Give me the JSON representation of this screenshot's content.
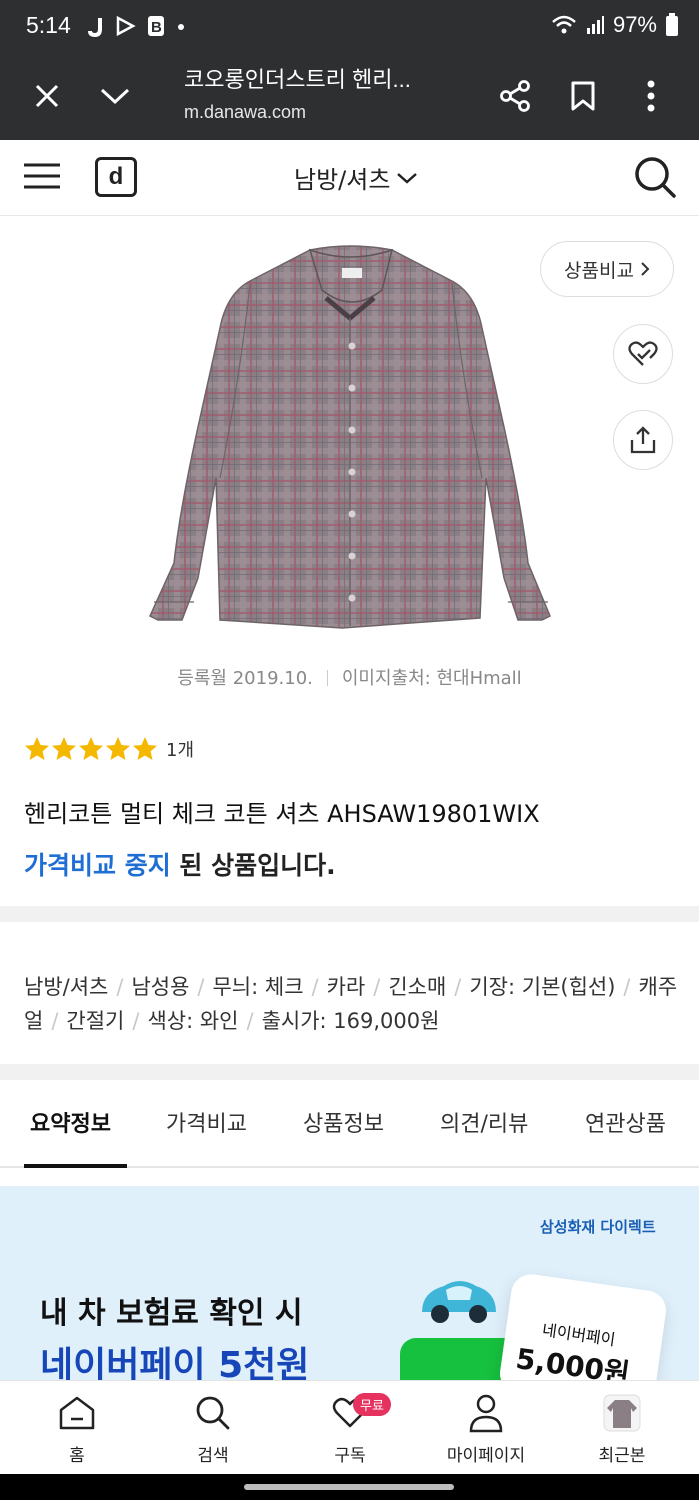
{
  "status_bar": {
    "time": "5:14",
    "battery": "97%"
  },
  "browser": {
    "title": "코오롱인더스트리 헨리...",
    "url": "m.danawa.com",
    "close_icon": "close-icon",
    "collapse_icon": "chevron-down-icon",
    "share_icon": "share-icon",
    "bookmark_icon": "bookmark-icon",
    "menu_icon": "more-vert-icon"
  },
  "header": {
    "logo": "d",
    "category": "남방/셔츠",
    "menu_icon": "hamburger-icon",
    "search_icon": "search-icon"
  },
  "product": {
    "compare_label": "상품비교",
    "image_meta_date": "등록월 2019.10.",
    "image_meta_source": "이미지출처: 현대Hmall",
    "rating_stars": 5,
    "review_count": "1개",
    "title": "헨리코튼 멀티 체크 코튼 셔츠 AHSAW19801WIX",
    "status_blue": "가격비교 중지",
    "status_rest": " 된 상품입니다."
  },
  "specs": [
    "남방/셔츠",
    "남성용",
    "무늬: 체크",
    "카라",
    "긴소매",
    "기장: 기본(힙선)",
    "캐주얼",
    "간절기",
    "색상: 와인",
    "출시가: 169,000원"
  ],
  "tabs": [
    {
      "label": "요약정보",
      "active": true
    },
    {
      "label": "가격비교",
      "active": false
    },
    {
      "label": "상품정보",
      "active": false
    },
    {
      "label": "의견/리뷰",
      "active": false
    },
    {
      "label": "연관상품",
      "active": false
    }
  ],
  "ad": {
    "brand": "삼성화재 다이렉트",
    "line1": "내 차 보험료 확인 시",
    "line2": "네이버페이 5천원",
    "card_label": "네이버페이",
    "card_amount": "5,000원"
  },
  "bottom_nav": [
    {
      "label": "홈",
      "icon": "home-icon"
    },
    {
      "label": "검색",
      "icon": "search-icon"
    },
    {
      "label": "구독",
      "icon": "subscribe-heart-icon",
      "badge": "무료"
    },
    {
      "label": "마이페이지",
      "icon": "user-icon"
    },
    {
      "label": "최근본",
      "icon": "recent-thumbnail-icon"
    }
  ],
  "colors": {
    "dark_bar": "#2d2f31",
    "accent_blue": "#1f6ed4",
    "star": "#f5b800",
    "badge": "#e5325f",
    "ad_bg": "#dff0fb"
  }
}
